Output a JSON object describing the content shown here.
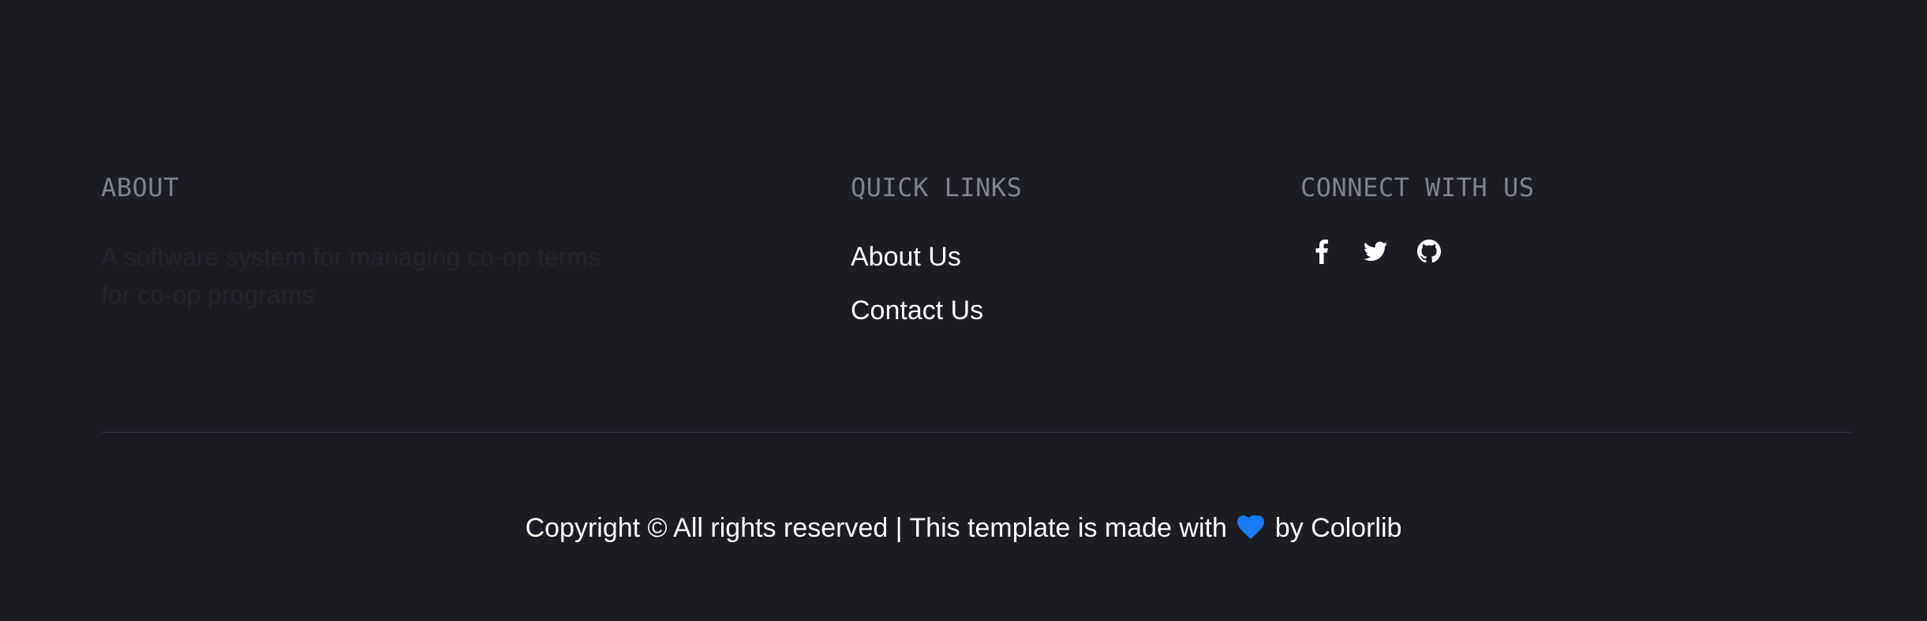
{
  "about": {
    "title": "ABOUT",
    "text_line1": "A software system for managing co-op terms",
    "text_line2": "for co-op programs"
  },
  "quick_links": {
    "title": "QUICK LINKS",
    "items": [
      {
        "label": "About Us"
      },
      {
        "label": "Contact Us"
      }
    ]
  },
  "connect": {
    "title": "CONNECT WITH US",
    "icons": [
      "facebook-icon",
      "twitter-icon",
      "github-icon"
    ]
  },
  "copyright": {
    "prefix": "Copyright © All rights reserved | This template is made with",
    "suffix": "by Colorlib",
    "heart_color": "#1a7cf2"
  },
  "colors": {
    "background": "#1b1d23",
    "heading": "#80838a",
    "about_text": "#25272c",
    "link": "#ffffff",
    "divider": "#34373e"
  }
}
